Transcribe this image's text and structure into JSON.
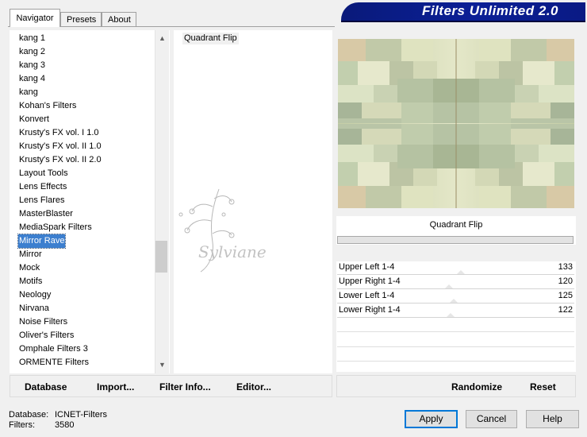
{
  "tabs": [
    {
      "label": "Navigator",
      "active": true
    },
    {
      "label": "Presets",
      "active": false
    },
    {
      "label": "About",
      "active": false
    }
  ],
  "app_title": "Filters Unlimited 2.0",
  "filter_list": {
    "items": [
      "kang 1",
      "kang 2",
      "kang 3",
      "kang 4",
      "kang",
      "Kohan's Filters",
      "Konvert",
      "Krusty's FX vol. I 1.0",
      "Krusty's FX vol. II 1.0",
      "Krusty's FX vol. II 2.0",
      "Layout Tools",
      "Lens Effects",
      "Lens Flares",
      "MasterBlaster",
      "MediaSpark Filters",
      "Mirror Rave",
      "Mirror",
      "Mock",
      "Motifs",
      "Neology",
      "Nirvana",
      "Noise Filters",
      "Oliver's Filters",
      "Omphale Filters 3",
      "ORMENTE Filters"
    ],
    "selected": "Mirror Rave"
  },
  "effect_list": {
    "items": [
      "Quadrant Flip"
    ],
    "selected": "Quadrant Flip"
  },
  "watermark_text": "Sylviane",
  "preview": {
    "filter_name": "Quadrant Flip"
  },
  "params": [
    {
      "label": "Upper Left 1-4",
      "value": 133
    },
    {
      "label": "Upper Right 1-4",
      "value": 120
    },
    {
      "label": "Lower Left 1-4",
      "value": 125
    },
    {
      "label": "Lower Right 1-4",
      "value": 122
    }
  ],
  "toolbar": {
    "database": "Database",
    "import": "Import...",
    "filter_info": "Filter Info...",
    "editor": "Editor...",
    "randomize": "Randomize",
    "reset": "Reset"
  },
  "status": {
    "database_label": "Database:",
    "database_value": "ICNET-Filters",
    "filters_label": "Filters:",
    "filters_value": "3580"
  },
  "dialog_buttons": {
    "apply": "Apply",
    "cancel": "Cancel",
    "help": "Help"
  },
  "colors": {
    "accent": "#0b1f96",
    "selection": "#3c7fcf"
  }
}
